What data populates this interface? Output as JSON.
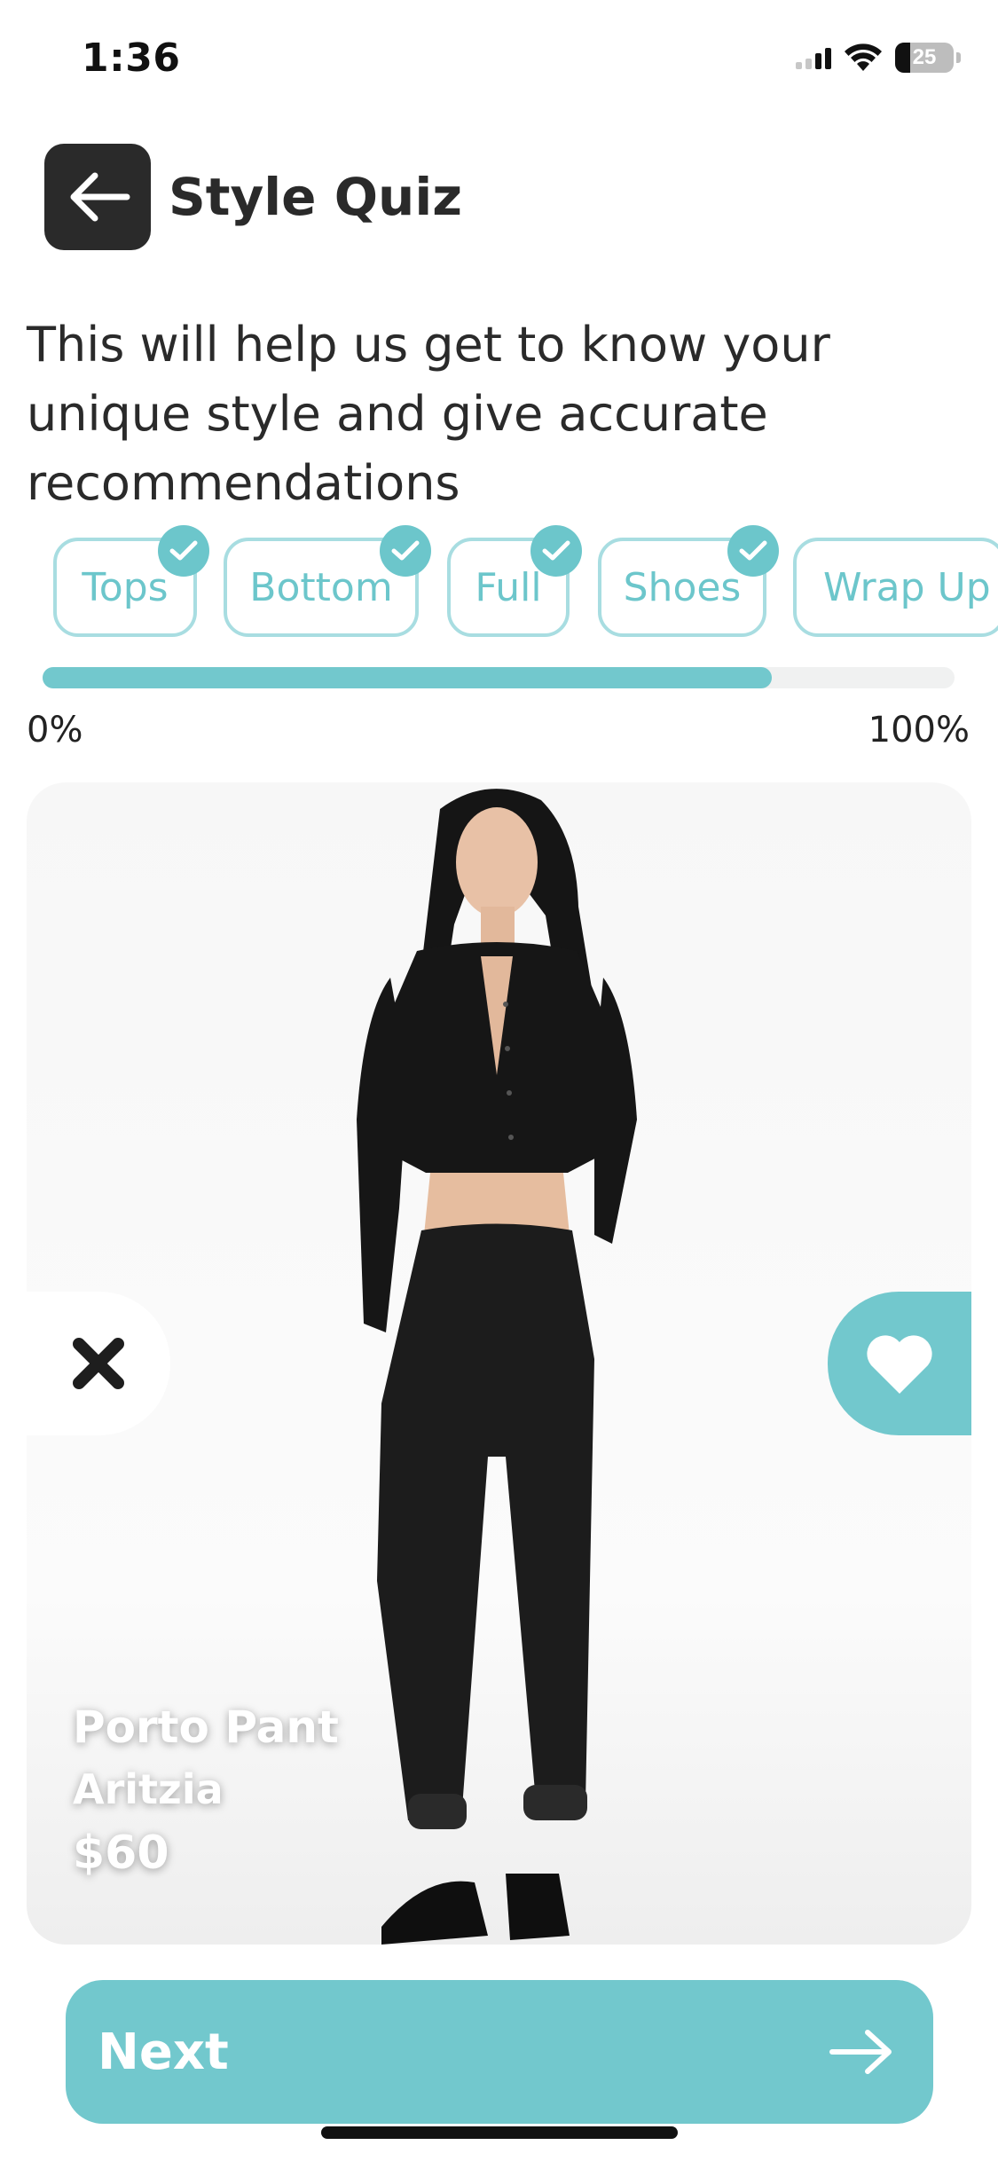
{
  "status_bar": {
    "time": "1:36",
    "battery_percent": "25",
    "icons": [
      "cellular-signal-icon",
      "wifi-icon",
      "battery-icon"
    ]
  },
  "header": {
    "back_icon": "arrow-left-icon",
    "title": "Style Quiz"
  },
  "intro": {
    "text": "This will help us get to know your unique style and give accurate recommendations"
  },
  "categories": [
    {
      "label": "Tops",
      "completed": true
    },
    {
      "label": "Bottom",
      "completed": true
    },
    {
      "label": "Full",
      "completed": true
    },
    {
      "label": "Shoes",
      "completed": true
    },
    {
      "label": "Wrap Up",
      "completed": false
    }
  ],
  "progress": {
    "value_fraction": 0.8,
    "min_label": "0%",
    "max_label": "100%"
  },
  "product": {
    "name": "Porto Pant",
    "brand": "Aritzia",
    "price": "$60",
    "dislike_icon": "close-icon",
    "like_icon": "heart-icon"
  },
  "footer": {
    "next_label": "Next",
    "next_icon": "arrow-right-icon"
  },
  "colors": {
    "accent": "#72c8cd",
    "chip_border": "#a8dde1",
    "chip_text": "#6cc6cb",
    "dark": "#2a2a2a"
  }
}
